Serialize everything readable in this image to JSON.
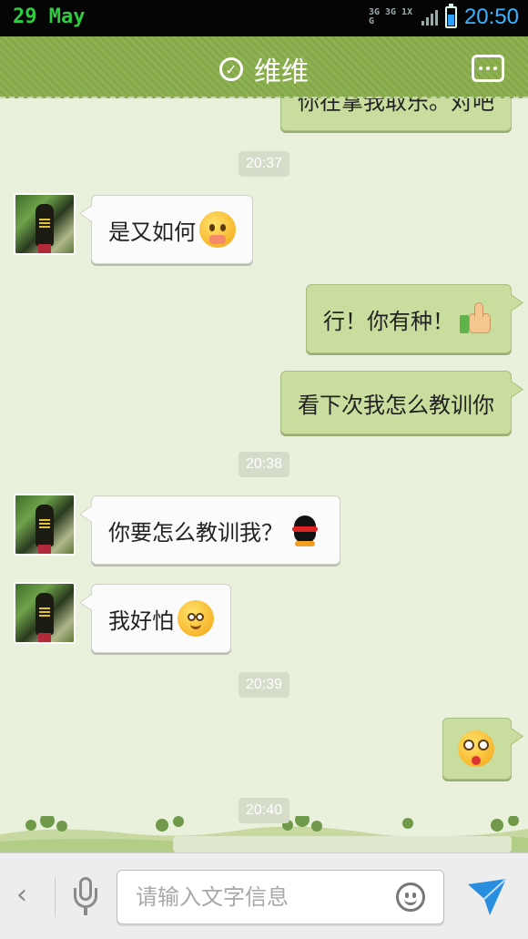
{
  "status_bar": {
    "date": "29 May",
    "network": "3G 3G 1X G",
    "time": "20:50"
  },
  "header": {
    "title": "维维"
  },
  "chat": {
    "partial_top_message": "你在拿我取乐。对吧",
    "messages": [
      {
        "type": "timestamp",
        "text": "20:37"
      },
      {
        "type": "incoming",
        "text": "是又如何",
        "emoji": "shy-emoji"
      },
      {
        "type": "outgoing",
        "text": "行！你有种！",
        "emoji": "thumbs-up-emoji"
      },
      {
        "type": "outgoing",
        "text": "看下次我怎么教训你"
      },
      {
        "type": "timestamp",
        "text": "20:38"
      },
      {
        "type": "incoming",
        "text": "你要怎么教训我？",
        "emoji": "ninja-penguin-emoji"
      },
      {
        "type": "incoming",
        "text": "我好怕",
        "emoji": "scared-emoji"
      },
      {
        "type": "timestamp",
        "text": "20:39"
      },
      {
        "type": "outgoing",
        "text": "",
        "emoji": "shocked-emoji"
      },
      {
        "type": "timestamp",
        "text": "20:40"
      }
    ]
  },
  "input_bar": {
    "placeholder": "请输入文字信息",
    "value": ""
  },
  "colors": {
    "header_green": "#8fb253",
    "outgoing_bubble": "#c8dd9e",
    "incoming_bubble": "#fbfbfb",
    "chat_bg": "#e9f1dc",
    "send_blue": "#2a8ee0"
  }
}
